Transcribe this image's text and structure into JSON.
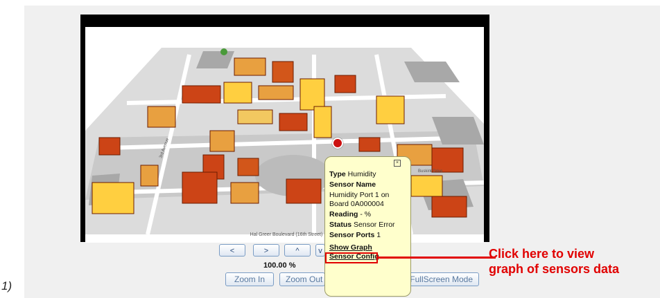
{
  "step_label": "1)",
  "map": {
    "street_labels": {
      "bottom": "Hal Greer Boulevard (16th Street)",
      "left": "3rd Avenue",
      "right": "Buskirk Drive"
    }
  },
  "nav": {
    "left": "<",
    "right": ">",
    "up": "^",
    "down": "v"
  },
  "zoom_level": "100.00 %",
  "buttons": {
    "zoom_in": "Zoom In",
    "zoom_out": "Zoom Out",
    "fullscreen": "FullScreen Mode"
  },
  "popup": {
    "close": "×",
    "type_label": "Type",
    "type_value": "Humidity",
    "sensor_name_label": "Sensor Name",
    "sensor_name_value": "Humidity Port 1 on Board 0A000004",
    "reading_label": "Reading",
    "reading_value": "- %",
    "status_label": "Status",
    "status_value": "Sensor Error",
    "ports_label": "Sensor Ports",
    "ports_value": "1",
    "show_graph": "Show Graph",
    "sensor_config": "Sensor Config"
  },
  "callout": {
    "line1": "Click here to view",
    "line2": "graph of sensors data",
    "color": "#e10000"
  }
}
